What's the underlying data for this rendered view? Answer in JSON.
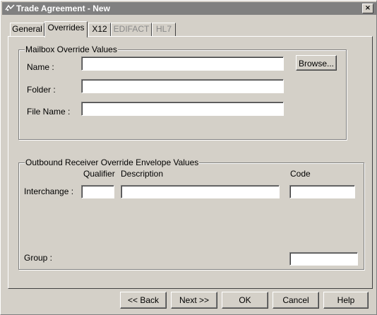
{
  "window": {
    "title": "Trade Agreement - New",
    "close_glyph": "×"
  },
  "tabs": [
    {
      "label": "General",
      "state": "normal"
    },
    {
      "label": "Overrides",
      "state": "active"
    },
    {
      "label": "X12",
      "state": "normal"
    },
    {
      "label": "EDIFACT",
      "state": "disabled"
    },
    {
      "label": "HL7",
      "state": "disabled"
    }
  ],
  "mailbox": {
    "legend": "Mailbox Override Values",
    "name_label": "Name :",
    "name_value": "",
    "folder_label": "Folder :",
    "folder_value": "",
    "filename_label": "File Name :",
    "filename_value": "",
    "browse_label": "Browse..."
  },
  "outbound": {
    "legend": "Outbound Receiver Override Envelope Values",
    "qualifier_header": "Qualifier",
    "description_header": "Description",
    "code_header": "Code",
    "interchange_label": "Interchange :",
    "interchange_qualifier": "",
    "interchange_description": "",
    "interchange_code": "",
    "group_label": "Group :",
    "group_code": ""
  },
  "footer": {
    "back_label": "<< Back",
    "next_label": "Next >>",
    "ok_label": "OK",
    "cancel_label": "Cancel",
    "help_label": "Help"
  },
  "colors": {
    "face": "#d4d0c8",
    "title_inactive": "#808080",
    "disabled_text": "#8a8a8a"
  }
}
